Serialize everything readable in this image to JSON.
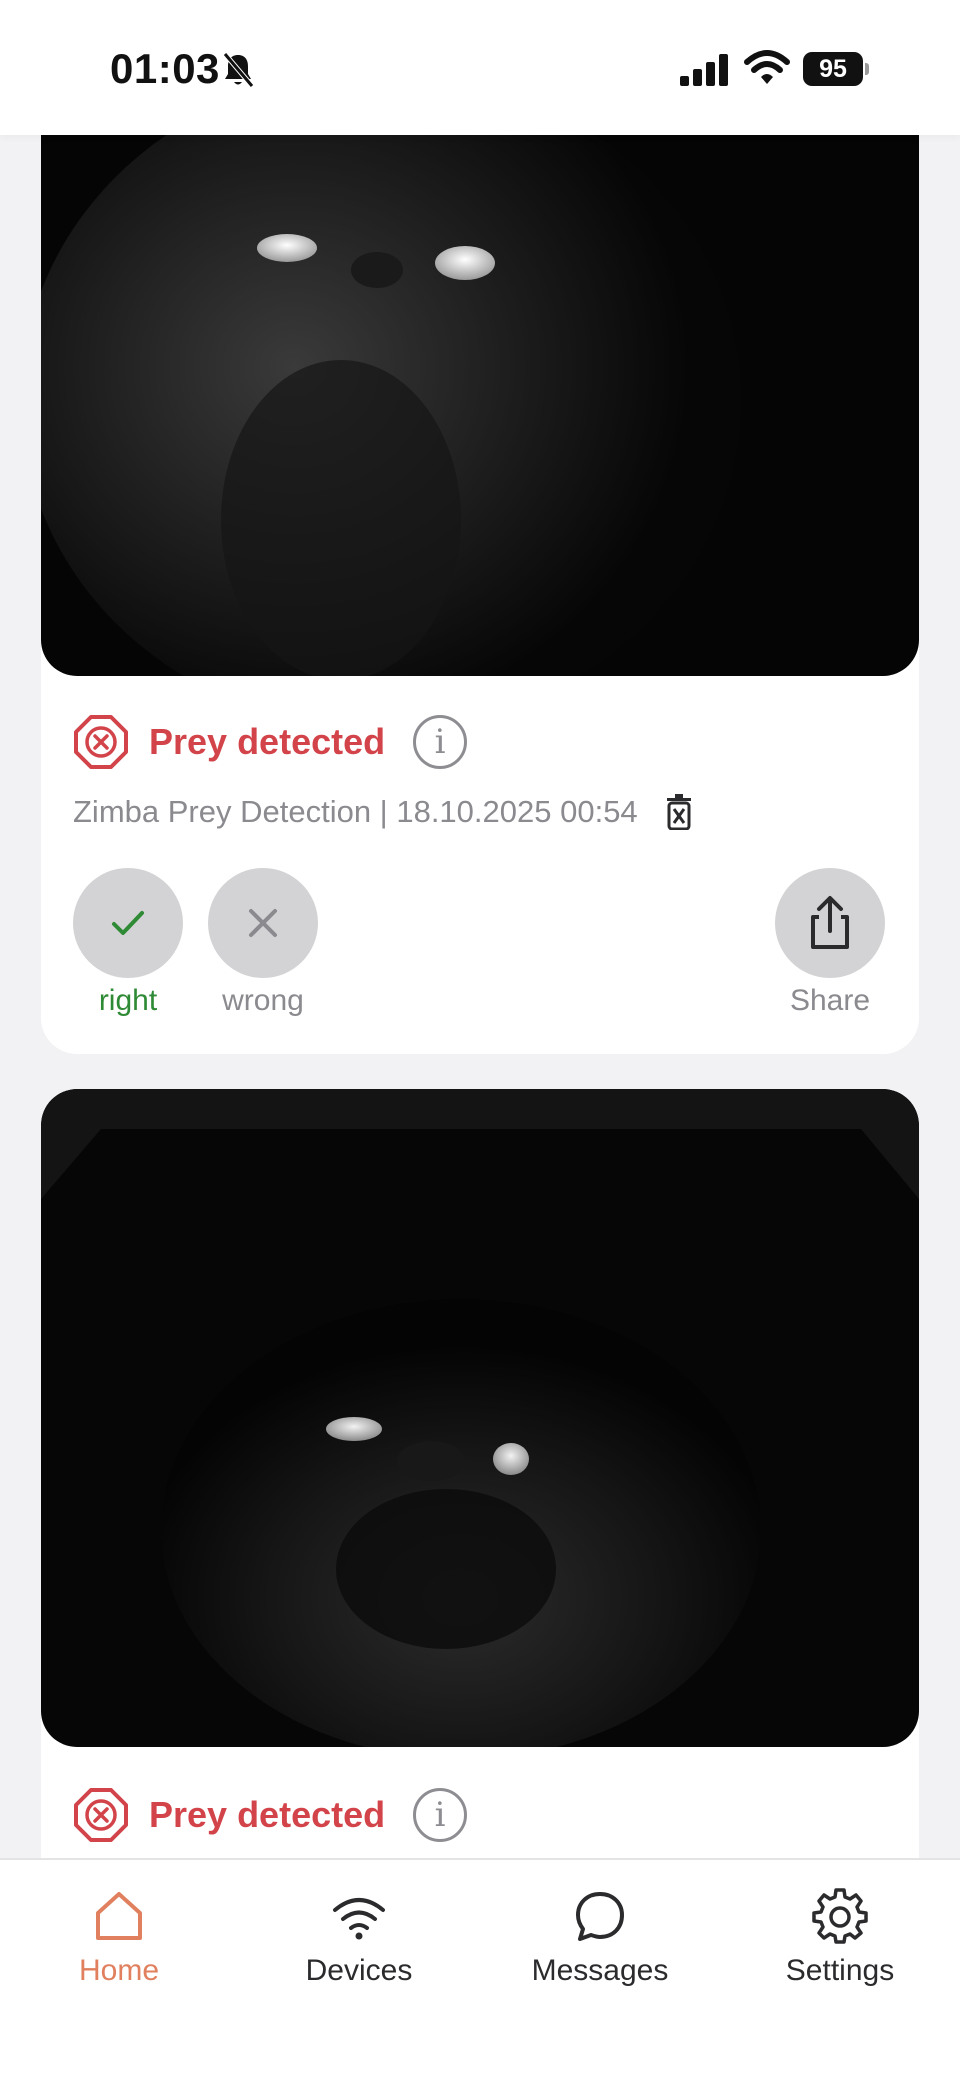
{
  "status_bar": {
    "time": "01:03",
    "battery": "95",
    "icons": [
      "bell-slash-icon",
      "cellular-signal-icon",
      "wifi-icon",
      "battery-icon"
    ]
  },
  "feed": {
    "cards": [
      {
        "result": "Prey detected",
        "meta": "Zimba Prey Detection | 18.10.2025 00:54",
        "feedback": {
          "right_label": "right",
          "wrong_label": "wrong",
          "share_label": "Share"
        }
      },
      {
        "result": "Prey detected"
      }
    ]
  },
  "tab_bar": {
    "active": "Home",
    "tabs": [
      {
        "label": "Home",
        "icon": "home-icon"
      },
      {
        "label": "Devices",
        "icon": "wifi-icon"
      },
      {
        "label": "Messages",
        "icon": "chat-bubble-icon"
      },
      {
        "label": "Settings",
        "icon": "gear-icon"
      }
    ]
  },
  "colors": {
    "prey_red": "#d2444a",
    "right_green": "#2f8a35",
    "active_tab": "#e0805f",
    "muted_gray": "#8a8a8f"
  }
}
